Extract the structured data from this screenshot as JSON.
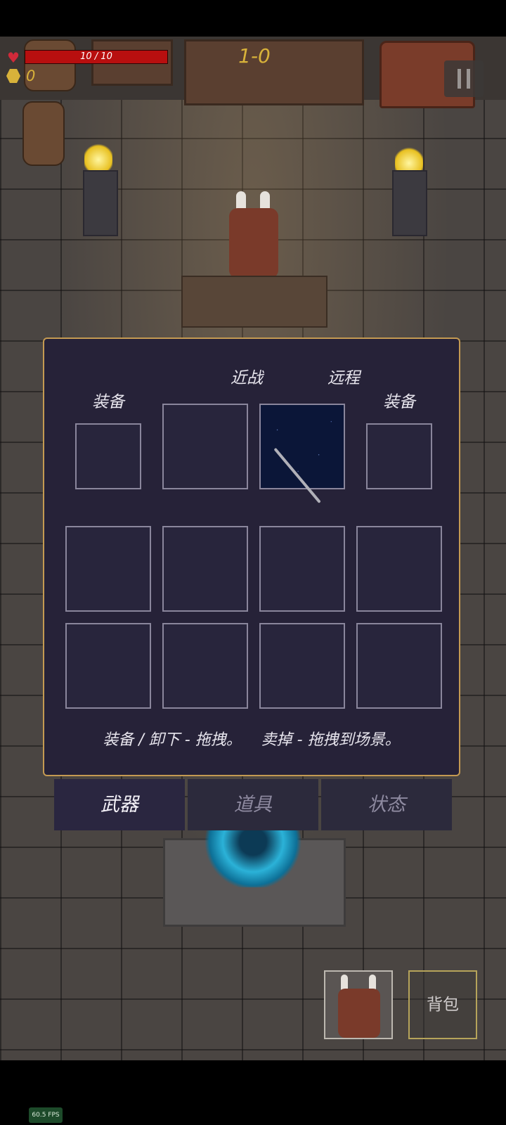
{
  "hud": {
    "hp_text": "10 / 10",
    "hp_fraction": 1.0,
    "coins": "0",
    "level": "1-0",
    "pause_label": "II"
  },
  "inventory": {
    "melee_label": "近战",
    "ranged_label": "远程",
    "equip_left_label": "装备",
    "equip_right_label": "装备",
    "ranged_item_icon": "wand-icon",
    "hint": "装备 / 卸下 - 拖拽。    卖掉 - 拖拽到场景。"
  },
  "tabs": [
    "武器",
    "道具",
    "状态"
  ],
  "bottom": {
    "bag_label": "背包"
  },
  "fps": "60.5 FPS",
  "colors": {
    "panel_bg": "#262238",
    "panel_border": "#c49a52",
    "hp_bar": "#b80f0f",
    "gold": "#d8b23a"
  }
}
